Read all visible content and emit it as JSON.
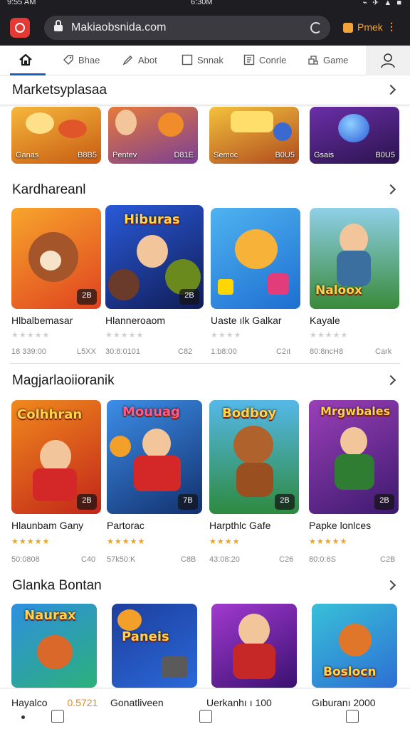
{
  "status_bar": {
    "left": "9:55 AM",
    "center": "6:30M",
    "right": "⌁ ✈ ▲ ■"
  },
  "browser": {
    "url": "Makiaobsnida.com",
    "extension_label": "Pmek",
    "extension_more": "⋮"
  },
  "nav": {
    "tabs": [
      {
        "label": "",
        "icon": "home-icon"
      },
      {
        "label": "Bhae",
        "icon": "tag-icon"
      },
      {
        "label": "Abot",
        "icon": "pen-icon"
      },
      {
        "label": "Snnak",
        "icon": "square-icon"
      },
      {
        "label": "Conrle",
        "icon": "grid-icon"
      },
      {
        "label": "Game",
        "icon": "gamepad-icon"
      }
    ],
    "profile_icon": "user-icon"
  },
  "sections": {
    "marketplace": {
      "title": "Marketsyplasaa",
      "tiles": [
        {
          "label": "Ganas",
          "count": "B8B5",
          "color_a": "#f6b73c",
          "color_b": "#c75b12"
        },
        {
          "label": "Pentev",
          "count": "D81E",
          "color_a": "#e77a3a",
          "color_b": "#7a3f96"
        },
        {
          "label": "Semoc",
          "count": "B0U5",
          "color_a": "#f3c23d",
          "color_b": "#b04a1e"
        },
        {
          "label": "Gsais",
          "count": "B0U5",
          "color_a": "#6b2fa8",
          "color_b": "#2a134d"
        }
      ]
    },
    "kardhareanl": {
      "title": "Kardhareanl",
      "games": [
        {
          "name": "Hlbalbemasar",
          "badge": "2B",
          "stars": "★★★★★",
          "star_color": "#cfcfcf",
          "meta_left": "18 339:00",
          "meta_right": "L5XX",
          "art_title": "",
          "color_a": "#f7a52c",
          "color_b": "#e0421f"
        },
        {
          "name": "Hlanneroaom",
          "badge": "2B",
          "stars": "★★★★★",
          "star_color": "#cfcfcf",
          "meta_left": "30:8:0101",
          "meta_right": "C82",
          "art_title": "Hiburas",
          "color_a": "#2a5ad9",
          "color_b": "#101c55"
        },
        {
          "name": "Uaste ılk Galkar",
          "badge": "",
          "stars": "★★★★",
          "star_color": "#cfcfcf",
          "meta_left": "1:b8:00",
          "meta_right": "C2ıt",
          "art_title": "",
          "color_a": "#4fb3f0",
          "color_b": "#1e6fd1"
        },
        {
          "name": "Kayale",
          "badge": "",
          "stars": "★★★★★",
          "star_color": "#cfcfcf",
          "meta_left": "80:8ncH8",
          "meta_right": "Cark",
          "art_title": "Naloox",
          "color_a": "#8fd0e8",
          "color_b": "#3a8a3a"
        }
      ]
    },
    "magjarlaoiioranik": {
      "title": "Magjarlaoiioranik",
      "games": [
        {
          "name": "Hlaunbam Gany",
          "badge": "2B",
          "stars": "★★★★★",
          "star_color": "#f0a21c",
          "meta_left": "50:0808",
          "meta_right": "C40",
          "art_title": "Colhhran",
          "color_a": "#f08a1c",
          "color_b": "#c2251a"
        },
        {
          "name": "Partorac",
          "badge": "7B",
          "stars": "★★★★★",
          "star_color": "#f0a21c",
          "meta_left": "57k50:K",
          "meta_right": "C8B",
          "art_title": "Mouuag",
          "color_a": "#3d8ee8",
          "color_b": "#12306e"
        },
        {
          "name": "Harpthlc Gafe",
          "badge": "2B",
          "stars": "★★★★",
          "star_color": "#f0a21c",
          "meta_left": "43:08:20",
          "meta_right": "C26",
          "art_title": "Bodboy",
          "color_a": "#55b8e8",
          "color_b": "#2d8a3f"
        },
        {
          "name": "Papke lonlces",
          "badge": "2B",
          "stars": "★★★★★",
          "star_color": "#f0a21c",
          "meta_left": "80:0:6S",
          "meta_right": "C2B",
          "art_title": "Mrgwbales",
          "color_a": "#9b3fb8",
          "color_b": "#3c1a6e"
        }
      ]
    },
    "glanka_bontan": {
      "title": "Glanka Bontan",
      "games": [
        {
          "name": "",
          "badge": "",
          "art_title": "Naurax",
          "color_a": "#2f8fe0",
          "color_b": "#2bb07a"
        },
        {
          "name": "",
          "badge": "",
          "art_title": "Paneis",
          "color_a": "#1d3f9e",
          "color_b": "#f2a02a"
        },
        {
          "name": "",
          "badge": "",
          "art_title": "",
          "color_a": "#a23ad0",
          "color_b": "#3a1070"
        },
        {
          "name": "",
          "badge": "",
          "art_title": "Boslocn",
          "color_a": "#38c0d8",
          "color_b": "#2d6fd4"
        }
      ]
    }
  },
  "bottom_bar": {
    "items": [
      {
        "label": "Hayalco",
        "price": "0.5721"
      },
      {
        "label": "Gonatliveen",
        "price": ""
      },
      {
        "label": "Uerkanhı ı 100",
        "price": ""
      },
      {
        "label": "Gıburanı 2000",
        "price": ""
      }
    ]
  }
}
